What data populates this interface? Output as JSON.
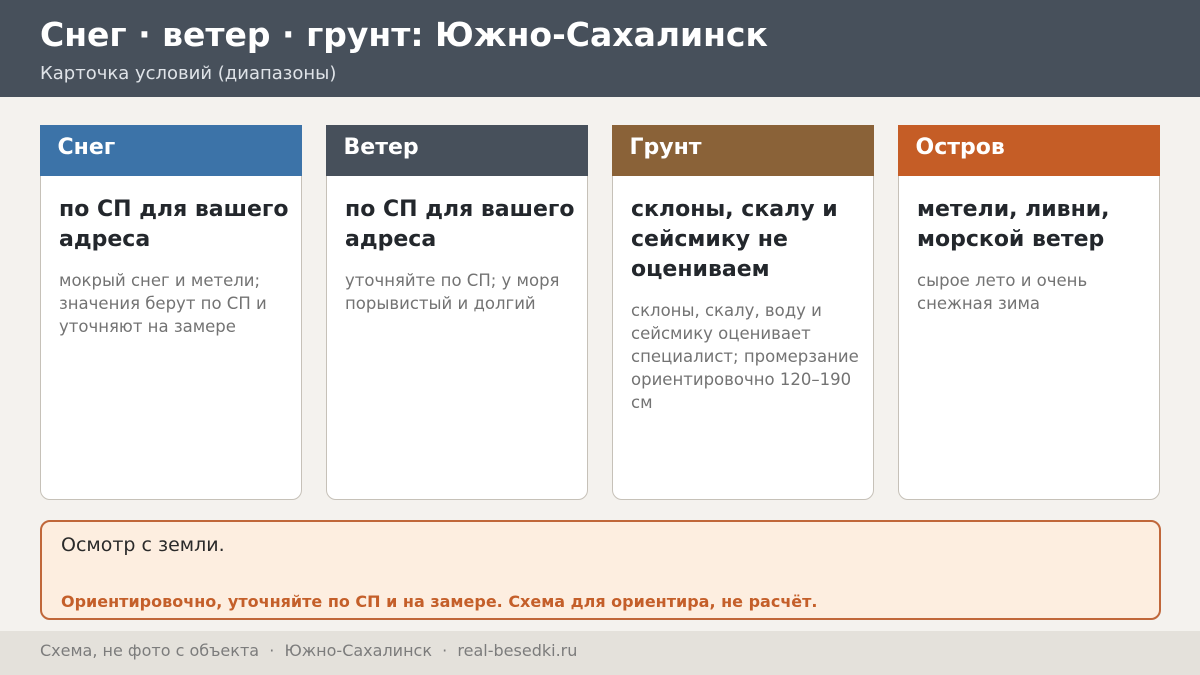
{
  "header": {
    "title": "Снег · ветер · грунт: Южно-Сахалинск",
    "subtitle": "Карточка условий (диапазоны)"
  },
  "cards": [
    {
      "label": "Снег",
      "color": "#3c73a8",
      "main": "по СП для вашего адреса",
      "note": "мокрый снег и метели; значения берут по СП и уточняют на замере"
    },
    {
      "label": "Ветер",
      "color": "#47505b",
      "main": "по СП для вашего адреса",
      "note": "уточняйте по СП; у моря порывистый и долгий"
    },
    {
      "label": "Грунт",
      "color": "#8a6238",
      "main": "склоны, скалу и сейсмику не оцениваем",
      "note": "склоны, скалу, воду и сейсмику оценивает специалист; промерзание ориентировочно 120–190 см"
    },
    {
      "label": "Остров",
      "color": "#c55d26",
      "main": "метели, ливни, морской ветер",
      "note": "сырое лето и очень снежная зима"
    }
  ],
  "notice": {
    "text": "Осмотр с земли.",
    "warning": "Ориентировочно, уточняйте по СП и на замере. Схема для ориентира, не расчёт."
  },
  "footer": {
    "text": "Схема, не фото с объекта  ·  Южно-Сахалинск  ·  real-besedki.ru"
  }
}
